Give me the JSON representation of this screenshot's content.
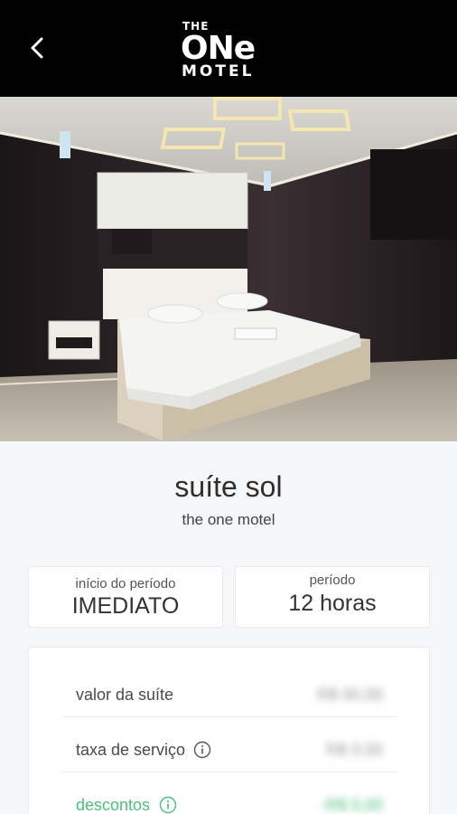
{
  "header": {
    "logo": {
      "the": "THE",
      "one": "ONe",
      "motel": "MOTEL"
    },
    "back_icon": "chevron-left-icon"
  },
  "suite": {
    "name": "suíte sol",
    "motel": "the one motel"
  },
  "period": {
    "start_label": "início do período",
    "start_value": "IMEDIATO",
    "duration_label": "período",
    "duration_value": "12 horas"
  },
  "pricing": {
    "rows": [
      {
        "label": "valor da suíte",
        "amount": "R$ 00,00",
        "has_info": false
      },
      {
        "label": "taxa de serviço",
        "amount": "R$ 0,00",
        "has_info": true
      },
      {
        "label": "descontos",
        "amount": "-R$ 0,00",
        "has_info": true
      }
    ]
  },
  "colors": {
    "header_bg": "#000000",
    "page_bg": "#f5f6f8",
    "discount_green": "#4bbf7b"
  }
}
